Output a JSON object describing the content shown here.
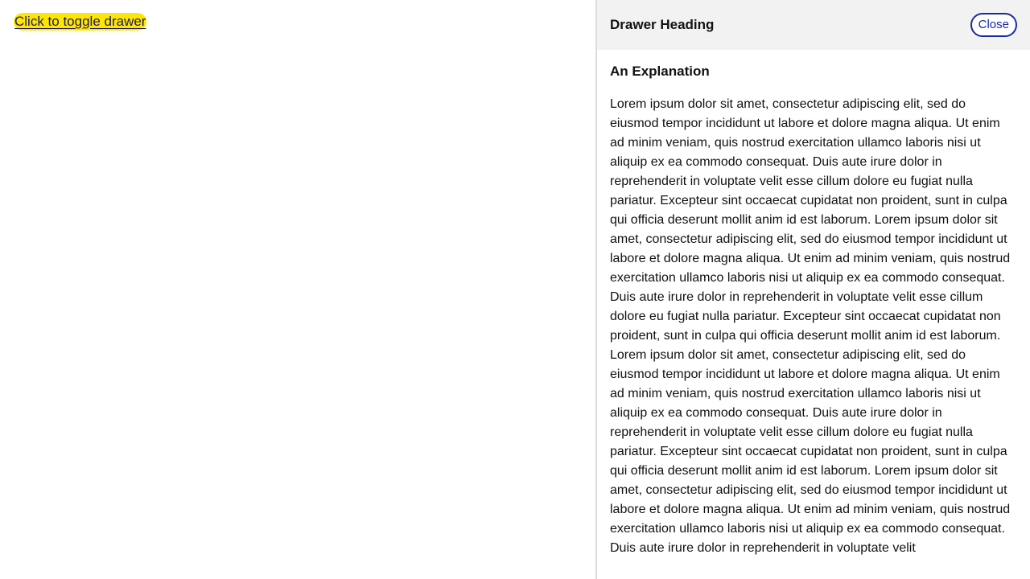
{
  "main": {
    "toggle_label": "Click to toggle drawer"
  },
  "drawer": {
    "heading": "Drawer Heading",
    "close_label": "Close",
    "section_heading": "An Explanation",
    "body": "Lorem ipsum dolor sit amet, consectetur adipiscing elit, sed do eiusmod tempor incididunt ut labore et dolore magna aliqua. Ut enim ad minim veniam, quis nostrud exercitation ullamco laboris nisi ut aliquip ex ea commodo consequat. Duis aute irure dolor in reprehenderit in voluptate velit esse cillum dolore eu fugiat nulla pariatur. Excepteur sint occaecat cupidatat non proident, sunt in culpa qui officia deserunt mollit anim id est laborum. Lorem ipsum dolor sit amet, consectetur adipiscing elit, sed do eiusmod tempor incididunt ut labore et dolore magna aliqua. Ut enim ad minim veniam, quis nostrud exercitation ullamco laboris nisi ut aliquip ex ea commodo consequat. Duis aute irure dolor in reprehenderit in voluptate velit esse cillum dolore eu fugiat nulla pariatur. Excepteur sint occaecat cupidatat non proident, sunt in culpa qui officia deserunt mollit anim id est laborum. Lorem ipsum dolor sit amet, consectetur adipiscing elit, sed do eiusmod tempor incididunt ut labore et dolore magna aliqua. Ut enim ad minim veniam, quis nostrud exercitation ullamco laboris nisi ut aliquip ex ea commodo consequat. Duis aute irure dolor in reprehenderit in voluptate velit esse cillum dolore eu fugiat nulla pariatur. Excepteur sint occaecat cupidatat non proident, sunt in culpa qui officia deserunt mollit anim id est laborum. Lorem ipsum dolor sit amet, consectetur adipiscing elit, sed do eiusmod tempor incididunt ut labore et dolore magna aliqua. Ut enim ad minim veniam, quis nostrud exercitation ullamco laboris nisi ut aliquip ex ea commodo consequat. Duis aute irure dolor in reprehenderit in voluptate velit"
  },
  "colors": {
    "toggle_highlight": "#ffe600",
    "close_accent": "#1a2a9e",
    "header_background": "#f2f2f2"
  }
}
